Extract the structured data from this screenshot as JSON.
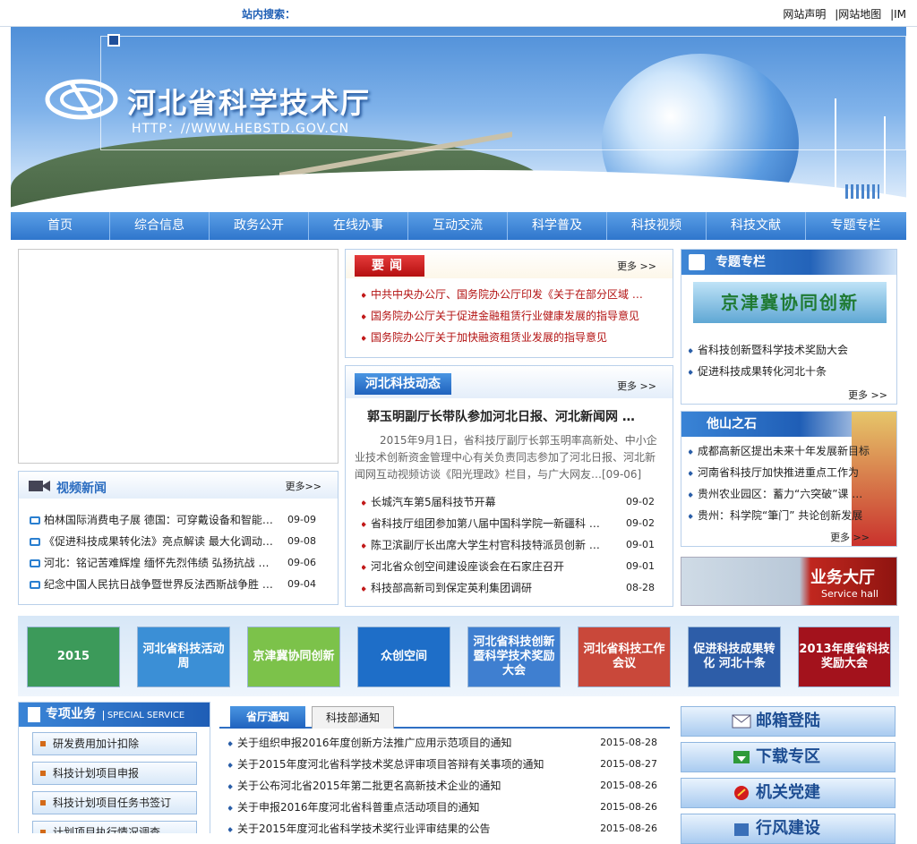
{
  "topbar": {
    "search_label": "站内搜索：",
    "links": [
      "网站声明",
      "|网站地图",
      "|IM"
    ]
  },
  "banner": {
    "title": "河北省科学技术厅",
    "url": "HTTP：//WWW.HEBSTD.GOV.CN"
  },
  "nav": [
    "首页",
    "综合信息",
    "政务公开",
    "在线办事",
    "互动交流",
    "科学普及",
    "科技视频",
    "科技文献",
    "专题专栏"
  ],
  "video_news": {
    "title": "视频新闻",
    "more": "更多>>",
    "items": [
      {
        "text": "柏林国际消费电子展 德国：可穿戴设备和智能…",
        "date": "09-09"
      },
      {
        "text": "《促进科技成果转化法》亮点解读 最大化调动…",
        "date": "09-08"
      },
      {
        "text": "河北：铭记苦难辉煌 缅怀先烈伟绩 弘扬抗战 …",
        "date": "09-06"
      },
      {
        "text": "纪念中国人民抗日战争暨世界反法西斯战争胜 …",
        "date": "09-04"
      }
    ]
  },
  "yaowen": {
    "title": "要闻",
    "more": "更多 >>",
    "items": [
      "中共中央办公厅、国务院办公厅印发《关于在部分区域 …",
      "国务院办公厅关于促进金融租赁行业健康发展的指导意见",
      "国务院办公厅关于加快融资租赁业发展的指导意见"
    ]
  },
  "dynamics": {
    "title": "河北科技动态",
    "more": "更多 >>",
    "headline": "郭玉明副厅长带队参加河北日报、河北新闻网 …",
    "summary": "2015年9月1日，省科技厅副厅长郭玉明率高新处、中小企业技术创新资金管理中心有关负责同志参加了河北日报、河北新闻网互动视频访谈《阳光理政》栏目，与广大网友…[09-06]",
    "items": [
      {
        "text": "长城汽车第5届科技节开幕",
        "date": "09-02"
      },
      {
        "text": "省科技厅组团参加第八届中国科学院一新疆科 …",
        "date": "09-02"
      },
      {
        "text": "陈卫滨副厅长出席大学生村官科技特派员创新 …",
        "date": "09-01"
      },
      {
        "text": "河北省众创空间建设座谈会在石家庄召开",
        "date": "09-01"
      },
      {
        "text": "科技部高新司到保定英利集团调研",
        "date": "08-28"
      }
    ]
  },
  "special": {
    "title": "专题专栏",
    "banner_text": "京津冀协同创新",
    "more": "更多 >>",
    "items": [
      "省科技创新暨科学技术奖励大会",
      "促进科技成果转化河北十条"
    ]
  },
  "taling": {
    "title": "他山之石",
    "more": "更多 >>",
    "items": [
      "成都高新区提出未来十年发展新目标",
      "河南省科技厅加快推进重点工作为",
      "贵州农业园区：蓄力“六突破”课 …",
      "贵州：科学院“筆门” 共论创新发展"
    ]
  },
  "service_hall": {
    "title": "业务大厅",
    "subtitle": "Service hall"
  },
  "thumbs": [
    "2015",
    "河北省科技活动周",
    "京津冀协同创新",
    "众创空间",
    "河北省科技创新暨科学技术奖励大会",
    "河北省科技工作会议",
    "促进科技成果转化 河北十条",
    "2013年度省科技奖励大会"
  ],
  "thumb_colors": [
    "#3c9a5a",
    "#3b8fd6",
    "#7cc24a",
    "#1e6ec8",
    "#3f7fd0",
    "#c9483a",
    "#2d5da8",
    "#a3121c"
  ],
  "zxyw": {
    "title": "专项业务",
    "subtitle": "SPECIAL SERVICE",
    "items": [
      "研发费用加计扣除",
      "科技计划项目申报",
      "科技计划项目任务书签订",
      "计划项目执行情况调查"
    ]
  },
  "notices": {
    "tabs": [
      "省厅通知",
      "科技部通知"
    ],
    "items": [
      {
        "text": "关于组织申报2016年度创新方法推广应用示范项目的通知",
        "date": "2015-08-28"
      },
      {
        "text": "关于2015年度河北省科学技术奖总评审项目答辩有关事项的通知",
        "date": "2015-08-27"
      },
      {
        "text": "关于公布河北省2015年第二批更名高新技术企业的通知",
        "date": "2015-08-26"
      },
      {
        "text": "关于申报2016年度河北省科普重点活动项目的通知",
        "date": "2015-08-26"
      },
      {
        "text": "关于2015年度河北省科学技术奖行业评审结果的公告",
        "date": "2015-08-26"
      }
    ]
  },
  "right_buttons": [
    "邮箱登陆",
    "下载专区",
    "机关党建",
    "行风建设"
  ]
}
